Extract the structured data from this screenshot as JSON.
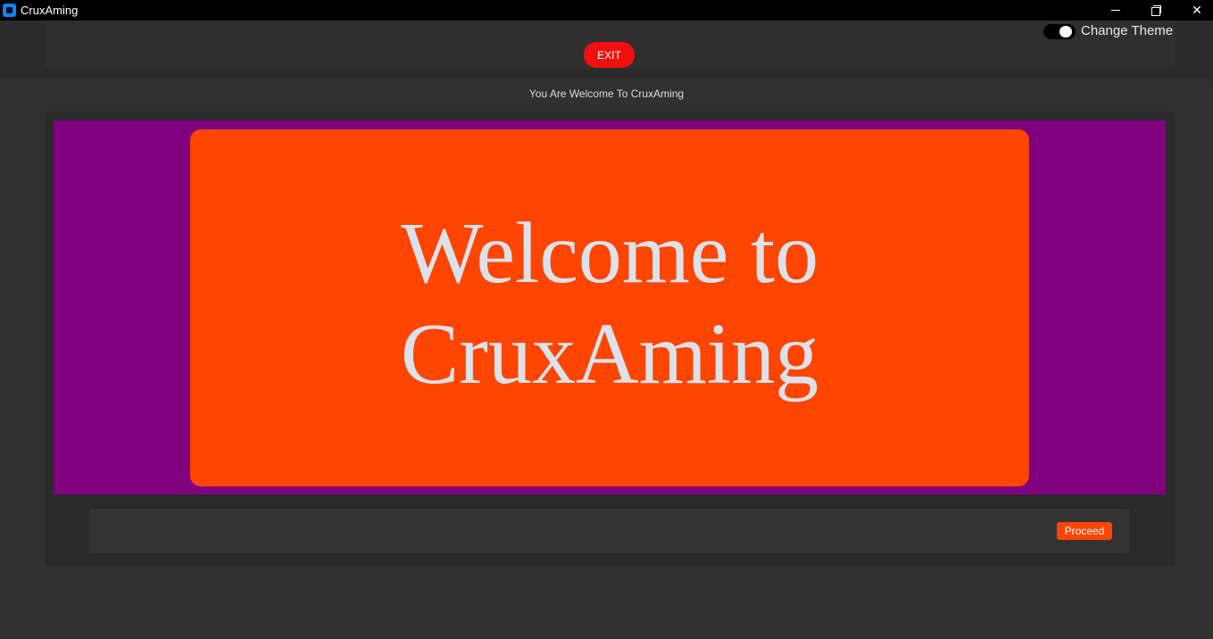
{
  "window": {
    "title": "CruxAming",
    "icon": "app-icon",
    "controls": [
      "minimize-icon",
      "restore-icon",
      "close-icon"
    ]
  },
  "header": {
    "exit_label": "EXIT",
    "theme_toggle_label": "Change Theme",
    "theme_toggle_on": true
  },
  "main": {
    "subtitle": "You Are Welcome To CruxAming",
    "welcome_text": "Welcome to CruxAming",
    "proceed_label": "Proceed"
  },
  "colors": {
    "titlebar": "#000000",
    "background": "#2b2b2b",
    "exit_button": "#f20f0f",
    "purple_panel": "#800080",
    "welcome_card": "#ff4500",
    "welcome_text": "#dde1ea",
    "proceed_button": "#ff4500"
  }
}
